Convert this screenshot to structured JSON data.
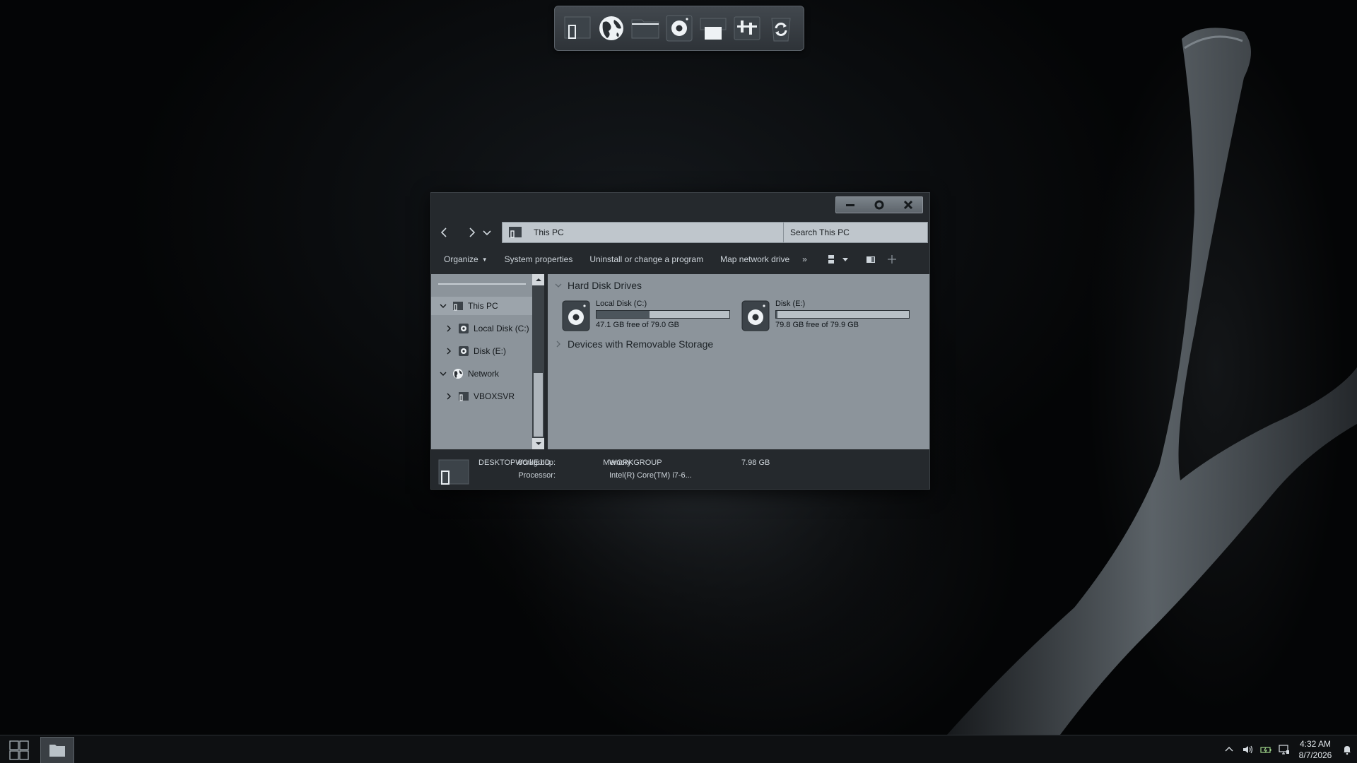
{
  "dock": {
    "items": [
      {
        "name": "computer-icon"
      },
      {
        "name": "network-globe-icon"
      },
      {
        "name": "folder-icon"
      },
      {
        "name": "disk-icon"
      },
      {
        "name": "printer-icon"
      },
      {
        "name": "settings-sliders-icon"
      },
      {
        "name": "recycle-bin-icon"
      }
    ]
  },
  "window": {
    "address": "This PC",
    "search_placeholder": "Search This PC",
    "commands": {
      "organize": "Organize",
      "system_properties": "System properties",
      "uninstall": "Uninstall or change a program",
      "map_drive": "Map network drive",
      "more": "»"
    },
    "nav_tree": [
      {
        "label": "This PC",
        "icon": "computer-icon",
        "expanded": true
      },
      {
        "label": "Local Disk (C:)",
        "icon": "disk-icon",
        "expanded": false
      },
      {
        "label": "Disk (E:)",
        "icon": "disk-icon",
        "expanded": false
      },
      {
        "label": "Network",
        "icon": "network-globe-icon",
        "expanded": true
      },
      {
        "label": "VBOXSVR",
        "icon": "computer-icon",
        "expanded": false
      }
    ],
    "groups": {
      "hard_disks": "Hard Disk Drives",
      "removable": "Devices with Removable Storage"
    },
    "drives": [
      {
        "name": "Local Disk (C:)",
        "free": "47.1 GB free of 79.0 GB",
        "used_fraction": 0.4
      },
      {
        "name": "Disk (E:)",
        "free": "79.8 GB free of 79.9 GB",
        "used_fraction": 0.01
      }
    ],
    "details": {
      "computer_name": "DESKTOP-8CUEJID",
      "workgroup_label": "Workgroup:",
      "workgroup": "WORKGROUP",
      "memory_label": "Memory:",
      "memory": "7.98 GB",
      "processor_label": "Processor:",
      "processor": "Intel(R) Core(TM) i7-6..."
    }
  },
  "taskbar": {
    "time": "4:32 AM",
    "date": "8/7/2026"
  }
}
